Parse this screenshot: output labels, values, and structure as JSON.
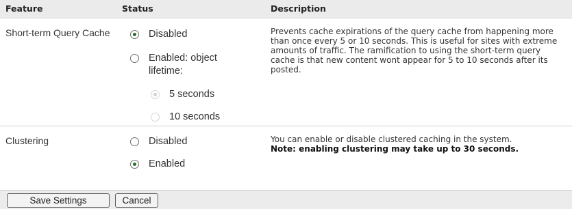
{
  "table": {
    "headers": {
      "feature": "Feature",
      "status": "Status",
      "description": "Description"
    }
  },
  "cache": {
    "feature": "Short-term Query Cache",
    "options": {
      "disabled": "Disabled",
      "enabled": "Enabled: object lifetime:",
      "five": "5 seconds",
      "ten": "10 seconds"
    },
    "selected": "Disabled",
    "description": "Prevents cache expirations of the query cache from happening more than once every 5 or 10 seconds. This is useful for sites with extreme amounts of traffic. The ramification to using the short-term query cache is that new content wont appear for 5 to 10 seconds after its posted."
  },
  "clustering": {
    "feature": "Clustering",
    "options": {
      "disabled": "Disabled",
      "enabled": "Enabled"
    },
    "selected": "Enabled",
    "description": "You can enable or disable clustered caching in the system.",
    "note": "Note: enabling clustering may take up to 30 seconds."
  },
  "buttons": {
    "save": "Save Settings",
    "cancel": "Cancel"
  }
}
